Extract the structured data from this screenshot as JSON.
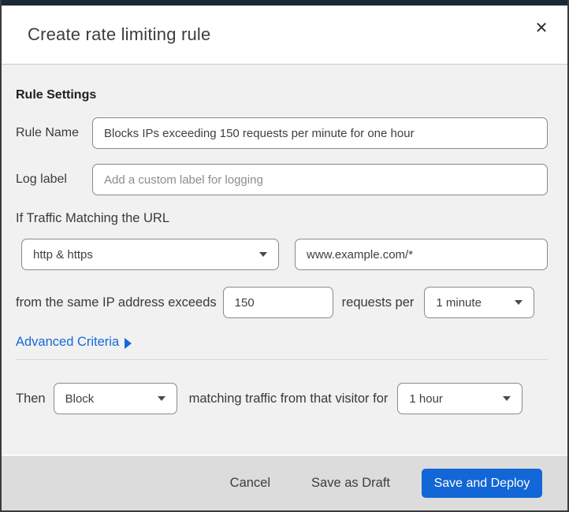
{
  "dialog": {
    "title": "Create rate limiting rule",
    "close_glyph": "✕"
  },
  "rule_settings": {
    "heading": "Rule Settings",
    "rule_name_label": "Rule Name",
    "rule_name_value": "Blocks IPs exceeding 150 requests per minute for one hour",
    "log_label_label": "Log label",
    "log_label_placeholder": "Add a custom label for logging"
  },
  "traffic_match": {
    "heading": "If Traffic Matching the URL",
    "scheme_selected": "http & https",
    "url_value": "www.example.com/*",
    "exceeds_text": "from the same IP address exceeds",
    "request_count": "150",
    "requests_per_text": "requests per",
    "period_selected": "1 minute",
    "advanced_label": "Advanced Criteria"
  },
  "action": {
    "then_label": "Then",
    "action_selected": "Block",
    "duration_text": "matching traffic from that visitor for",
    "duration_selected": "1 hour"
  },
  "footer": {
    "cancel_label": "Cancel",
    "save_draft_label": "Save as Draft",
    "save_deploy_label": "Save and Deploy"
  },
  "colors": {
    "primary_blue": "#1266d6",
    "link_blue": "#1669d8",
    "body_bg": "#f1f1f2",
    "footer_bg": "#dcdcdc",
    "top_band": "#1d2836"
  }
}
